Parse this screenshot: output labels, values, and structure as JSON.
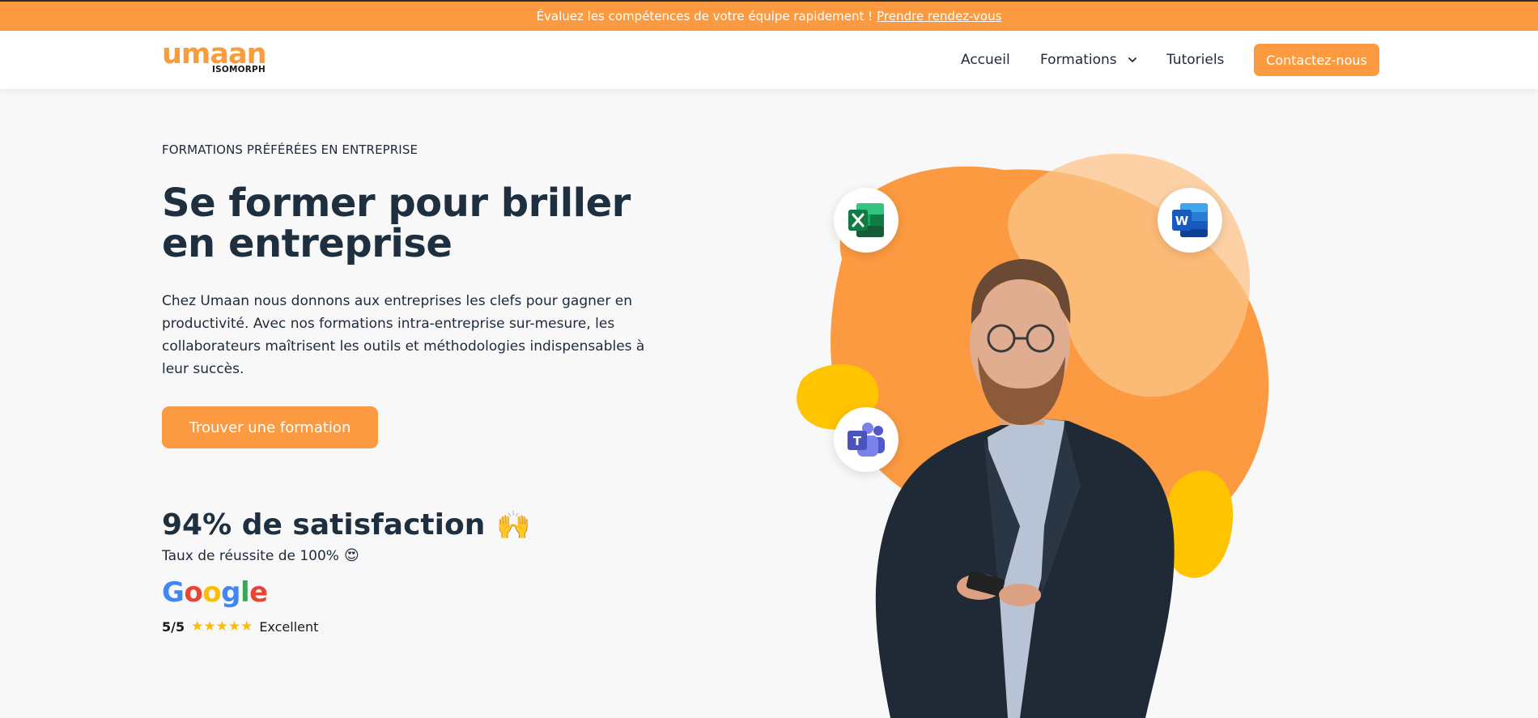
{
  "banner": {
    "text": "Évaluez les compétences de votre équipe rapidement !",
    "link": "Prendre rendez-vous"
  },
  "header": {
    "logo_main": "umaan",
    "logo_sub": "ISOMORPH",
    "nav": {
      "accueil": "Accueil",
      "formations": "Formations",
      "tutoriels": "Tutoriels"
    },
    "contact_label": "Contactez-nous"
  },
  "hero": {
    "kicker": "FORMATIONS PRÉFÉRÉES EN ENTREPRISE",
    "title": "Se former pour briller en entreprise",
    "description": "Chez Umaan nous donnons aux entreprises les clefs pour gagner en productivité. Avec nos formations intra-entreprise sur-mesure, les collaborateurs maîtrisent les outils et méthodologies indispensables à leur succès.",
    "cta_label": "Trouver une formation"
  },
  "stats": {
    "satisfaction": "94% de satisfaction",
    "satisfaction_emoji": "🙌",
    "success": "Taux de réussite de 100%",
    "success_emoji": "😍"
  },
  "google_rating": {
    "brand": [
      "G",
      "o",
      "o",
      "g",
      "l",
      "e"
    ],
    "score": "5/5",
    "stars": "★★★★★",
    "rating_value": 5,
    "rating_max": 5,
    "label": "Excellent"
  },
  "colors": {
    "brand_orange": "#fb9a40",
    "text_dark": "#1e2f40",
    "yellow_blob": "#ffc400",
    "google_blue": "#4285f4",
    "google_red": "#ea4335",
    "google_yellow": "#fbbc05",
    "google_green": "#34a853"
  },
  "icons": {
    "excel": "excel-icon",
    "word": "word-icon",
    "teams": "teams-icon",
    "chevron": "chevron-down-icon"
  }
}
